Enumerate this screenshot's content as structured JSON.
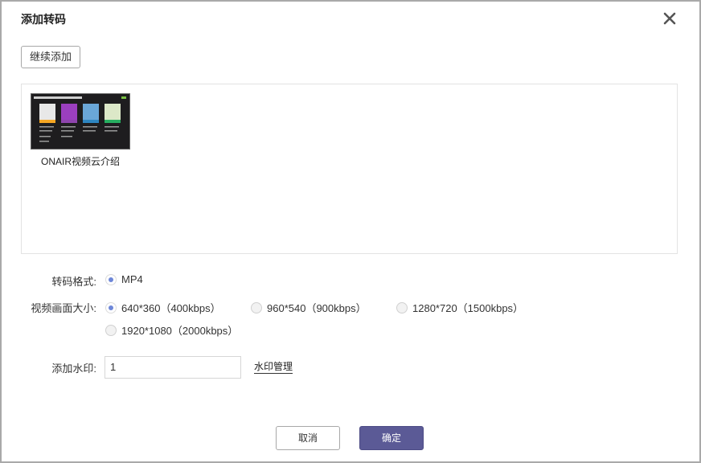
{
  "dialog": {
    "title": "添加转码",
    "close_icon": "close-icon"
  },
  "toolbar": {
    "continue_add_label": "继续添加"
  },
  "files": [
    {
      "name": "ONAIR视频云介绍",
      "thumbnail_icon": "video-thumbnail"
    }
  ],
  "form": {
    "format": {
      "label": "转码格式:",
      "options": [
        {
          "label": "MP4",
          "selected": true
        }
      ]
    },
    "size": {
      "label": "视频画面大小:",
      "options": [
        {
          "label": "640*360（400kbps）",
          "selected": true
        },
        {
          "label": "960*540（900kbps）",
          "selected": false
        },
        {
          "label": "1280*720（1500kbps）",
          "selected": false
        },
        {
          "label": "1920*1080（2000kbps）",
          "selected": false
        }
      ]
    },
    "watermark": {
      "label": "添加水印:",
      "value": "1",
      "manage_label": "水印管理"
    }
  },
  "footer": {
    "cancel_label": "取消",
    "confirm_label": "确定"
  },
  "colors": {
    "primary_button": "#5b5a96",
    "radio_checked": "#6e87d8",
    "dialog_border": "#a9a9a9"
  }
}
